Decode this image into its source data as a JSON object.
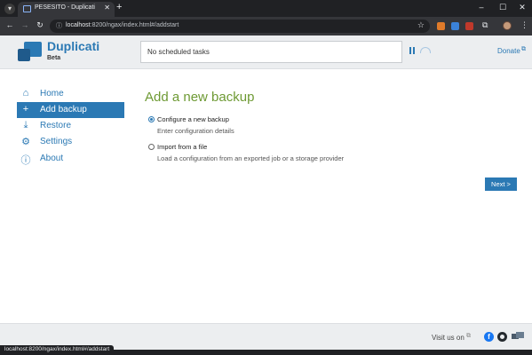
{
  "browser": {
    "tab_title": "PESESITO - Duplicati",
    "url_host": "localhost",
    "url_rest": ":8200/ngax/index.html#/addstart",
    "status_url": "localhost:8200/ngax/index.html#/addstart"
  },
  "header": {
    "brand": "Duplicati",
    "brand_sub": "Beta",
    "status": "No scheduled tasks",
    "donate": "Donate"
  },
  "sidebar": {
    "items": [
      {
        "label": "Home",
        "icon": "home-icon"
      },
      {
        "label": "Add backup",
        "icon": "plus-icon"
      },
      {
        "label": "Restore",
        "icon": "restore-icon"
      },
      {
        "label": "Settings",
        "icon": "gear-icon"
      },
      {
        "label": "About",
        "icon": "info-icon"
      }
    ],
    "active_index": 1
  },
  "main": {
    "title": "Add a new backup",
    "options": [
      {
        "label": "Configure a new backup",
        "description": "Enter configuration details",
        "selected": true
      },
      {
        "label": "Import from a file",
        "description": "Load a configuration from an exported job or a storage provider",
        "selected": false
      }
    ],
    "next_label": "Next >"
  },
  "footer": {
    "visit": "Visit us on"
  },
  "colors": {
    "accent": "#2b79b4",
    "title_green": "#6e9a34",
    "header_bg": "#eceef0"
  }
}
